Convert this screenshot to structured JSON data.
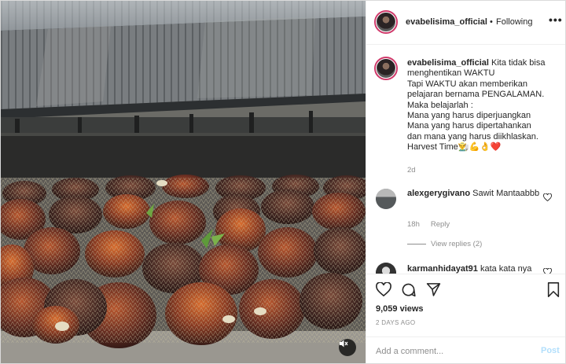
{
  "header": {
    "username": "evabelisima_official",
    "separator": "•",
    "follow_status": "Following",
    "more_icon": "more-horizontal-icon",
    "more_label": "•••"
  },
  "caption": {
    "username": "evabelisima_official",
    "text": " Kita tidak bisa menghentikan WAKTU\nTapi WAKTU akan memberikan pelajaran bernama PENGALAMAN.\nMaka belajarlah :\nMana yang harus diperjuangkan\nMana yang harus dipertahankan\ndan mana yang harus diikhlaskan.\nHarvest Time👨‍🌾💪👌❤️",
    "time": "2d"
  },
  "comments": [
    {
      "username": "alexgerygivano",
      "text": " Sawit Mantaabbb",
      "time": "18h",
      "reply_label": "Reply",
      "view_replies": "View replies (2)"
    },
    {
      "username": "karmanhidayat91",
      "text": " kata kata nya"
    }
  ],
  "actions": {
    "like_icon": "heart-icon",
    "comment_icon": "comment-icon",
    "share_icon": "share-icon",
    "save_icon": "bookmark-icon"
  },
  "stats": {
    "views": "9,059 views",
    "date": "2 DAYS AGO"
  },
  "add_comment": {
    "placeholder": "Add a comment...",
    "post_label": "Post"
  },
  "colors": {
    "accent_ring": "#d03a6b",
    "post_disabled": "#b2dffc",
    "muted": "#8e8e8e"
  }
}
